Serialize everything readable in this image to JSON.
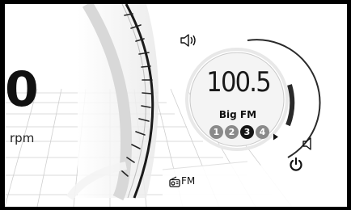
{
  "tachometer": {
    "rpm_value": "0",
    "rpm_unit": "rpm"
  },
  "radio": {
    "frequency": "100.5",
    "station_name": "Big FM",
    "presets": [
      {
        "label": "1",
        "state": "inactive"
      },
      {
        "label": "2",
        "state": "inactive"
      },
      {
        "label": "3",
        "state": "selected"
      },
      {
        "label": "4",
        "state": "inactive"
      }
    ],
    "source_label": "FM",
    "volume_level": 0.28
  },
  "icons": {
    "volume_up": "speaker-with-waves-icon",
    "volume_down": "speaker-icon",
    "power": "power-icon",
    "next": "triangle-right-icon",
    "source": "radio-icon"
  },
  "colors": {
    "preset_inactive": "#8a8a8a",
    "preset_selected": "#141414",
    "text": "#111111"
  }
}
